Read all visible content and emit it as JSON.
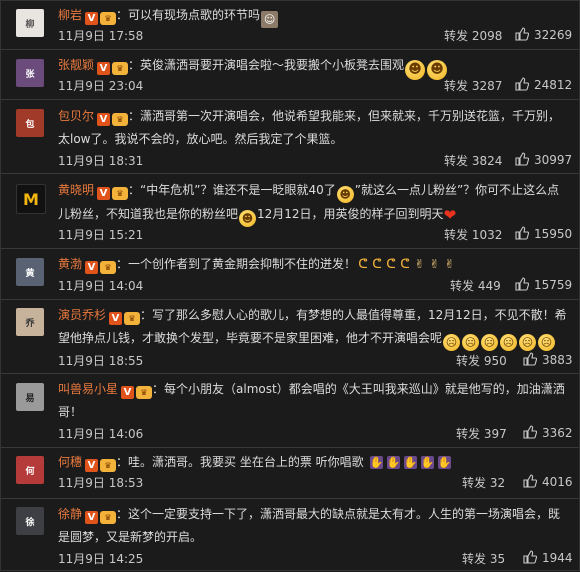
{
  "ui": {
    "colon": "："
  },
  "comments": [
    {
      "user": "柳岩",
      "text": "可以有现场点歌的环节吗",
      "date": "11月9日 17:58",
      "repost_label": "转发",
      "reposts": "2098",
      "likes": "32269",
      "avatar": "柳"
    },
    {
      "user": "张靓颖",
      "text": "英俊潇洒哥要开演唱会啦～我要搬个小板凳去围观",
      "date": "11月9日 23:04",
      "repost_label": "转发",
      "reposts": "3287",
      "likes": "24812",
      "avatar": "张"
    },
    {
      "user": "包贝尔",
      "text": "潇洒哥第一次开演唱会，他说希望我能来，但来就来，千万别送花篮，千万别，太low了。我说不会的，放心吧。然后我定了个果篮。",
      "date": "11月9日 18:31",
      "repost_label": "转发",
      "reposts": "3824",
      "likes": "30997",
      "avatar": "包"
    },
    {
      "user": "黄晓明",
      "text_a": "“中年危机”？谁还不是一眨眼就40了",
      "text_b": "”就这么一点儿粉丝”？你可不止这么点儿粉丝，不知道我也是你的粉丝吧",
      "text_c": "12月12日，用英俊的样子回到明天",
      "date": "11月9日 15:21",
      "repost_label": "转发",
      "reposts": "1032",
      "likes": "15950",
      "avatar": "M"
    },
    {
      "user": "黄渤",
      "text": "一个创作者到了黄金期会抑制不住的迸发！",
      "date": "11月9日 14:04",
      "repost_label": "转发",
      "reposts": "449",
      "likes": "15759",
      "avatar": "黄"
    },
    {
      "user": "演员乔杉",
      "text": "写了那么多慰人心的歌儿，有梦想的人最值得尊重，12月12日，不见不散！希望他挣点儿钱，才敢换个发型，毕竟要不是家里困难，他才不开演唱会呢",
      "date": "11月9日 18:55",
      "repost_label": "转发",
      "reposts": "950",
      "likes": "3883",
      "avatar": "乔"
    },
    {
      "user": "叫兽易小星",
      "text": "每个小朋友（almost）都会唱的《大王叫我来巡山》就是他写的，加油潇洒哥！",
      "date": "11月9日 14:06",
      "repost_label": "转发",
      "reposts": "397",
      "likes": "3362",
      "avatar": "易"
    },
    {
      "user": "何穗",
      "text": "哇。潇洒哥。我要买 坐在台上的票 听你唱歌",
      "date": "11月9日 18:53",
      "repost_label": "转发",
      "reposts": "32",
      "likes": "4016",
      "avatar": "何"
    },
    {
      "user": "徐静",
      "text": "这个一定要支持一下了，潇洒哥最大的缺点就是太有才。人生的第一场演唱会，既是圆梦，又是新梦的开启。",
      "date": "11月9日 14:25",
      "repost_label": "转发",
      "reposts": "35",
      "likes": "1944",
      "avatar": "徐"
    }
  ]
}
